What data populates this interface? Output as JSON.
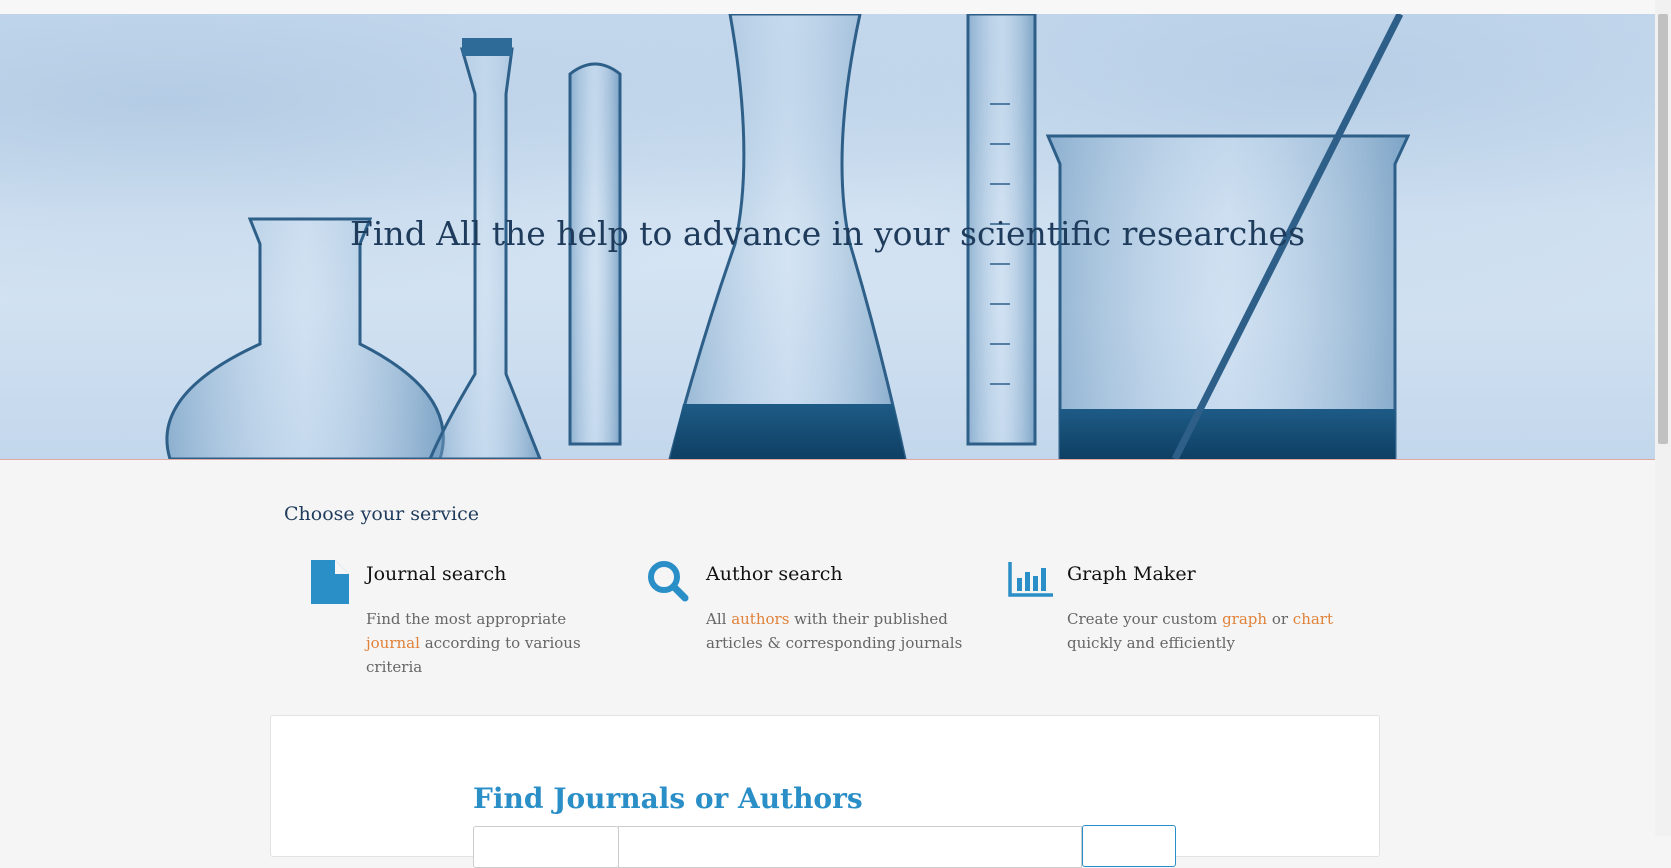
{
  "hero": {
    "title": "Find All the help to advance in your scientific researches"
  },
  "services": {
    "title": "Choose your service",
    "items": [
      {
        "name": "Journal search",
        "icon": "file-icon",
        "pre": "Find the most appropriate ",
        "link": "journal",
        "post": "  according to various criteria"
      },
      {
        "name": "Author search",
        "icon": "search-icon",
        "pre": "All ",
        "link": "authors",
        "post": "  with their published articles & corresponding journals"
      },
      {
        "name": "Graph Maker",
        "icon": "bar-chart-icon",
        "pre": "Create your custom ",
        "link": "graph",
        "mid": "  or ",
        "link2": "chart",
        "post": " quickly and efficiently"
      }
    ]
  },
  "search": {
    "title": "Find Journals or Authors"
  },
  "colors": {
    "accent": "#2a8ec7",
    "highlight": "#e0823a",
    "heading": "#1f3b5c"
  }
}
